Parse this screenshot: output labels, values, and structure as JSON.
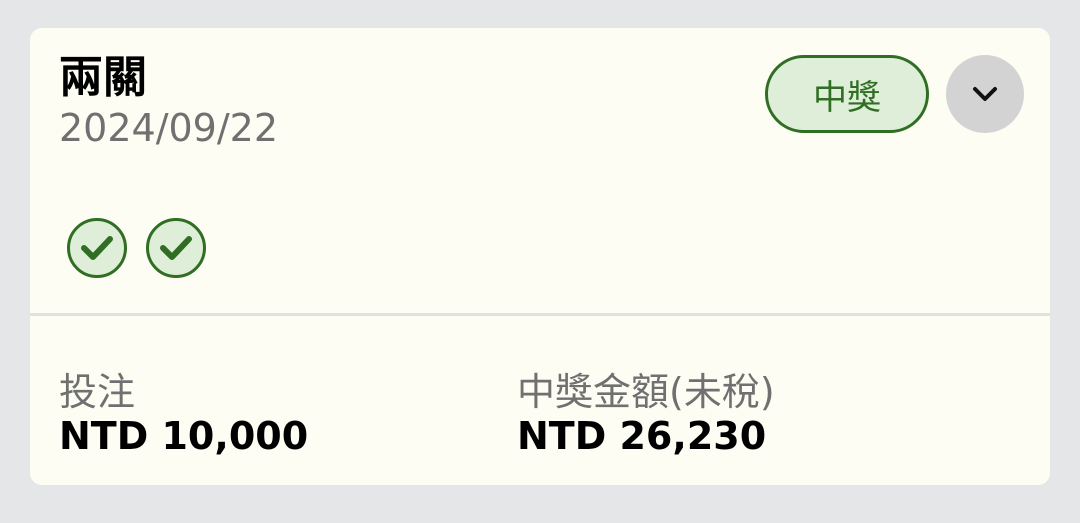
{
  "card": {
    "title": "兩關",
    "date": "2024/09/22",
    "status_badge": "中獎",
    "expand_icon": "chevron-down-icon",
    "legs": [
      {
        "result": "won",
        "icon": "check-circle-icon"
      },
      {
        "result": "won",
        "icon": "check-circle-icon"
      }
    ],
    "stake_label": "投注",
    "stake_value": "NTD 10,000",
    "payout_label": "中獎金額(未稅)",
    "payout_value": "NTD 26,230"
  },
  "colors": {
    "background": "#e5e6e8",
    "card": "#fdfdf4",
    "win_green": "#2f6e23",
    "win_fill": "#dfeed8",
    "muted_text": "#707070"
  }
}
